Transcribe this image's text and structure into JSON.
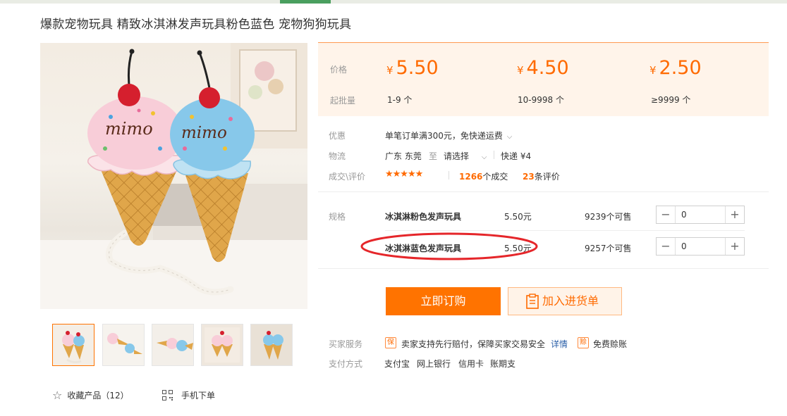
{
  "product": {
    "title": "爆款宠物玩具 精致冰淇淋发声玩具粉色蓝色 宠物狗狗玩具"
  },
  "price": {
    "price_label": "价格",
    "moq_label": "起批量",
    "currency": "¥",
    "tiers": [
      {
        "price": "5.50",
        "qty": "1-9 个"
      },
      {
        "price": "4.50",
        "qty": "10-9998 个"
      },
      {
        "price": "2.50",
        "qty": "≥9999 个"
      }
    ]
  },
  "info": {
    "promo_label": "优惠",
    "promo_text": "单笔订单满300元，免快递运费",
    "logistics_label": "物流",
    "origin": "广东 东莞",
    "to": "至",
    "destination": "请选择",
    "shipping": "快递 ¥4",
    "deals_label": "成交\\评价",
    "stars": "★★★★★",
    "deals_count": "1266",
    "deals_suffix": "个成交",
    "reviews_count": "23",
    "reviews_suffix": "条评价"
  },
  "spec": {
    "label": "规格",
    "items": [
      {
        "name": "冰淇淋粉色发声玩具",
        "price": "5.50元",
        "stock": "9239个可售",
        "qty": "0"
      },
      {
        "name": "冰淇淋蓝色发声玩具",
        "price": "5.50元",
        "stock": "9257个可售",
        "qty": "0"
      }
    ]
  },
  "actions": {
    "order": "立即订购",
    "cart": "加入进货单"
  },
  "service": {
    "label": "买家服务",
    "guarantee": "卖家支持先行赔付，保障买家交易安全",
    "details": "详情",
    "free_credit": "免费赊账",
    "icon1": "保",
    "icon2": "赊"
  },
  "payment": {
    "label": "支付方式",
    "methods": [
      "支付宝",
      "网上银行",
      "信用卡",
      "账期支"
    ]
  },
  "gallery": {
    "favorite": "收藏产品（12）",
    "mobile_order": "手机下单",
    "logo_text": "mimo"
  },
  "colors": {
    "accent": "#ff6a00",
    "button": "#ff7300",
    "panel": "#fff4ea",
    "annotation": "#e5262a"
  }
}
